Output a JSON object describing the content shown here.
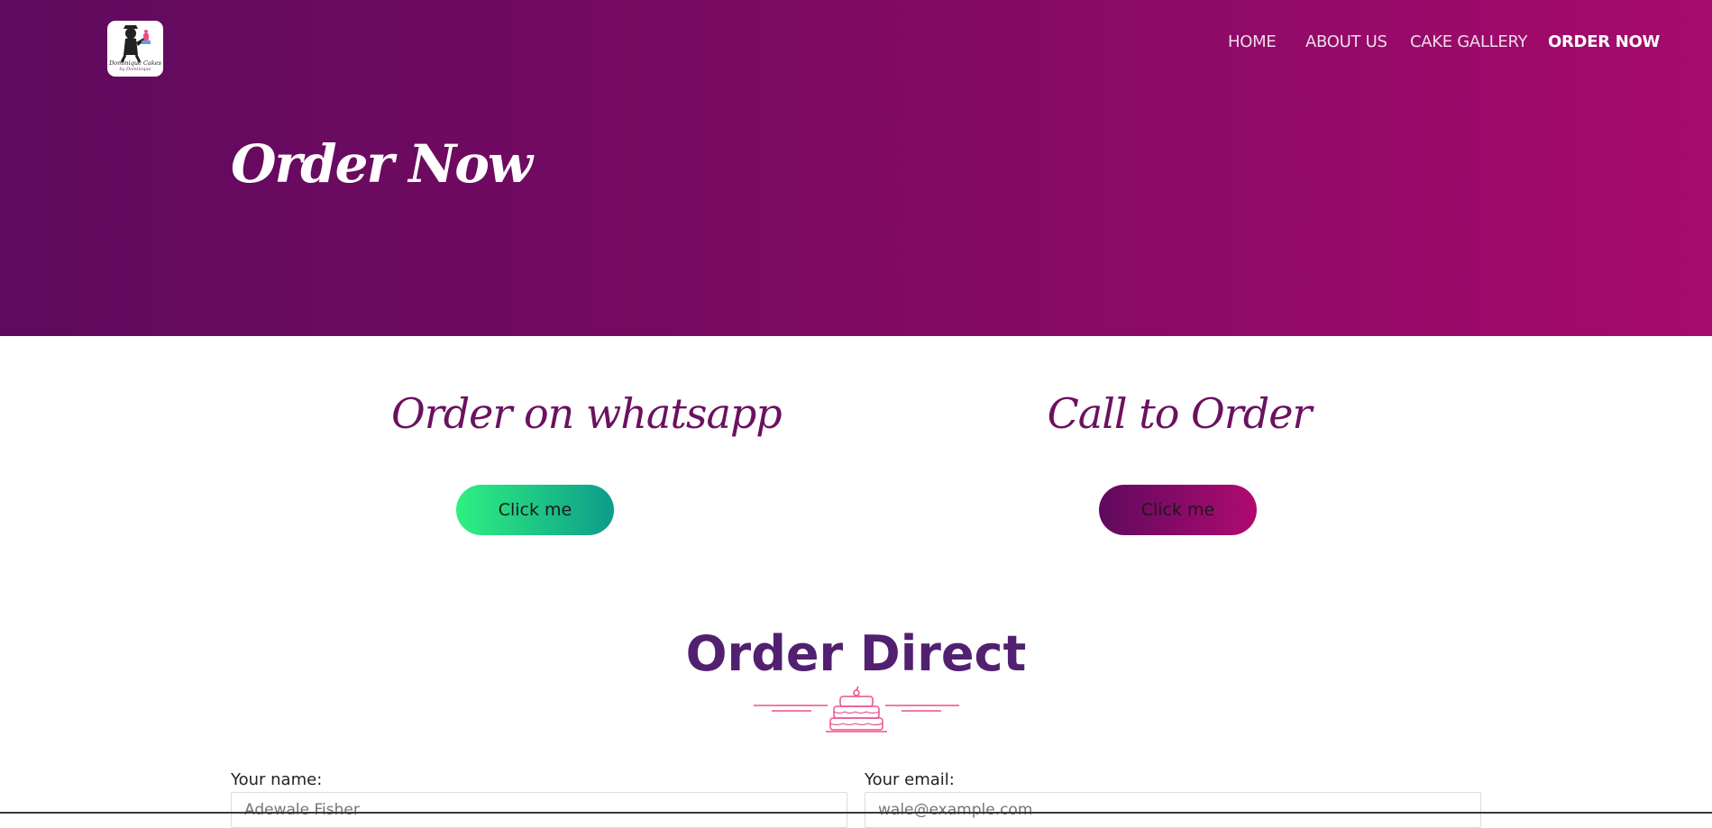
{
  "brand": {
    "logo_text": "Dominique Cakes",
    "logo_subtext": "by Dominique"
  },
  "nav": {
    "items": [
      {
        "label": "HOME"
      },
      {
        "label": "ABOUT US"
      },
      {
        "label": "CAKE GALLERY"
      },
      {
        "label": "ORDER NOW"
      }
    ],
    "active_index": 3
  },
  "hero": {
    "title": "Order Now"
  },
  "whatsapp": {
    "heading": "Order on whatsapp",
    "button_label": "Click me"
  },
  "call": {
    "heading": "Call to Order",
    "button_label": "Click me"
  },
  "direct": {
    "title": "Order Direct"
  },
  "form": {
    "name_label": "Your name:",
    "name_placeholder": "Adewale Fisher",
    "email_label": "Your email:",
    "email_placeholder": "wale@example.com"
  },
  "colors": {
    "hero_start": "#5e0a5e",
    "hero_end": "#a60a6c",
    "heading_purple": "#6b1160",
    "whatsapp_green": "#2ff080",
    "whatsapp_teal": "#0d9c8a",
    "cake_pink": "#e8508c"
  }
}
